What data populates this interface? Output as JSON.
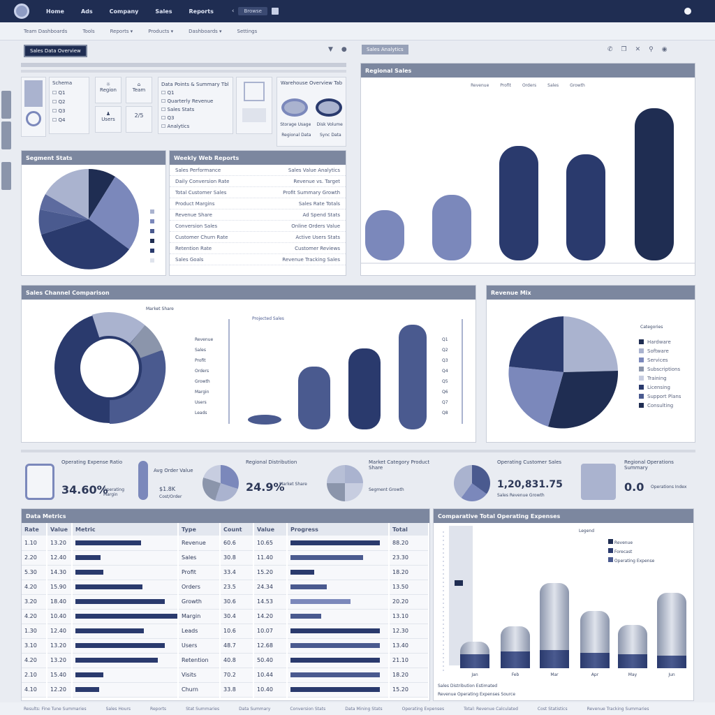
{
  "topnav": {
    "items": [
      "Home",
      "Ads",
      "Company",
      "Sales",
      "Reports"
    ],
    "search_label": "Browse"
  },
  "subnav": {
    "items": [
      "Team Dashboards",
      "Tools",
      "Reports ▾",
      "Products ▾",
      "Dashboards ▾",
      "Settings"
    ]
  },
  "left_tab": "Sales Data Overview",
  "right_tab": "Sales Analytics",
  "filter_card": {
    "title": "Schema",
    "checks": [
      "Q1",
      "Q2",
      "Q3",
      "Q4"
    ]
  },
  "mini_cards": [
    "Region",
    "Team",
    "Users",
    "2/5"
  ],
  "opts_card": {
    "title": "Data Points & Summary Tbl",
    "items": [
      "Q1",
      "Quarterly Revenue",
      "Sales Stats",
      "Q3",
      "Analytics"
    ]
  },
  "disk_card": {
    "title": "Warehouse Overview Tab",
    "labels": [
      "Storage Usage",
      "Disk Volume"
    ],
    "footer": [
      "Regional Data",
      "Sync Data"
    ]
  },
  "pie1_panel": {
    "title": "Segment Stats"
  },
  "keyvalue_panel": {
    "title": "Weekly Web Reports",
    "rows": [
      [
        "Sales Performance",
        "Sales Value Analytics"
      ],
      [
        "Daily Conversion Rate",
        "Revenue vs. Target"
      ],
      [
        "Total Customer Sales",
        "Profit Summary Growth"
      ],
      [
        "Product Margins",
        "Sales Rate Totals"
      ],
      [
        "Revenue Share",
        "Ad Spend Stats"
      ],
      [
        "Conversion Sales",
        "Online Orders Value"
      ],
      [
        "Customer Churn Rate",
        "Active Users Stats"
      ],
      [
        "Retention Rate",
        "Customer Reviews"
      ],
      [
        "Sales Goals",
        "Revenue Tracking Sales"
      ]
    ]
  },
  "bar1_panel": {
    "title": "Regional Sales",
    "legend": [
      "Revenue",
      "Profit",
      "Orders",
      "Sales",
      "Growth"
    ]
  },
  "wide_panel": {
    "title": "Sales Channel Comparison",
    "donut_label": "Market Share",
    "center_legend": "Projected Sales",
    "ticks": [
      "Revenue",
      "Sales",
      "Profit",
      "Orders",
      "Growth",
      "Margin",
      "Users",
      "Leads"
    ],
    "right_ticks": [
      "Q1",
      "Q2",
      "Q3",
      "Q4",
      "Q5",
      "Q6",
      "Q7",
      "Q8"
    ]
  },
  "pie2_panel": {
    "title": "Revenue Mix",
    "legend_title": "Categories",
    "legend": [
      "Hardware",
      "Software",
      "Services",
      "Subscriptions",
      "Training",
      "Licensing",
      "Support Plans",
      "Consulting"
    ]
  },
  "kpis": [
    {
      "title": "Operating Expense Ratio",
      "value": "34.60%",
      "sub": "Operating Margin"
    },
    {
      "title": "Avg Order Value",
      "value": "$1.8K",
      "sub": "Cost/Order"
    },
    {
      "title": "Regional Distribution",
      "value": "24.9%",
      "sub": "Market Share"
    },
    {
      "title": "Market Category Product Share",
      "value": "",
      "sub": "Segment Growth"
    },
    {
      "title": "Operating Customer Sales",
      "value": "1,20,831.75",
      "sub": "Sales Revenue Growth"
    },
    {
      "title": "Regional Operations Summary",
      "value": "0.0",
      "sub": "Operations Index"
    }
  ],
  "table_panel": {
    "title": "Data Metrics",
    "headers": [
      "Rate",
      "Value",
      "Metric",
      "Type",
      "Count",
      "Value",
      "Progress",
      "Total"
    ],
    "rows": [
      [
        "1.10",
        "13.20",
        "Revenue",
        "60.6",
        "10.65",
        "88.20"
      ],
      [
        "2.20",
        "12.40",
        "Sales",
        "30.8",
        "11.40",
        "23.30"
      ],
      [
        "5.30",
        "14.30",
        "Profit",
        "33.4",
        "15.20",
        "18.20"
      ],
      [
        "4.20",
        "15.90",
        "Orders",
        "23.5",
        "24.34",
        "13.50"
      ],
      [
        "3.20",
        "18.40",
        "Growth",
        "30.6",
        "14.53",
        "20.20"
      ],
      [
        "4.20",
        "10.40",
        "Margin",
        "30.4",
        "14.20",
        "13.10"
      ],
      [
        "1.30",
        "12.40",
        "Leads",
        "10.6",
        "10.07",
        "12.30"
      ],
      [
        "3.10",
        "13.20",
        "Users",
        "48.7",
        "12.68",
        "13.40"
      ],
      [
        "4.20",
        "13.20",
        "Retention",
        "40.8",
        "50.40",
        "21.10"
      ],
      [
        "2.10",
        "15.40",
        "Visits",
        "70.2",
        "10.44",
        "18.20"
      ],
      [
        "4.10",
        "12.20",
        "Churn",
        "33.8",
        "10.40",
        "15.20"
      ]
    ]
  },
  "cyl_panel": {
    "title": "Comparative Total Operating Expenses",
    "subtitle": "Legend",
    "legend": [
      "Revenue",
      "Forecast",
      "Operating Expense"
    ],
    "categories": [
      "Jan",
      "Feb",
      "Mar",
      "Apr",
      "May",
      "Jun"
    ],
    "footer": [
      "Sales Distribution Estimated",
      "Revenue Operating Expenses Source"
    ]
  },
  "footer": [
    "Results: Fine Tune Summaries",
    "Sales Hours",
    "Reports",
    "Stat Summaries",
    "Data Summary",
    "Conversion Stats",
    "Data Mining Stats",
    "Operating Expenses",
    "Total: Revenue Calculated",
    "Cost Statistics",
    "Revenue Tracking Summaries"
  ],
  "colors": {
    "navy": "#1f2d52",
    "dark": "#2a3a6d",
    "mid": "#4a5a8f",
    "light": "#7b88bb",
    "pale": "#aab3cf",
    "grey": "#8b95ab"
  }
}
